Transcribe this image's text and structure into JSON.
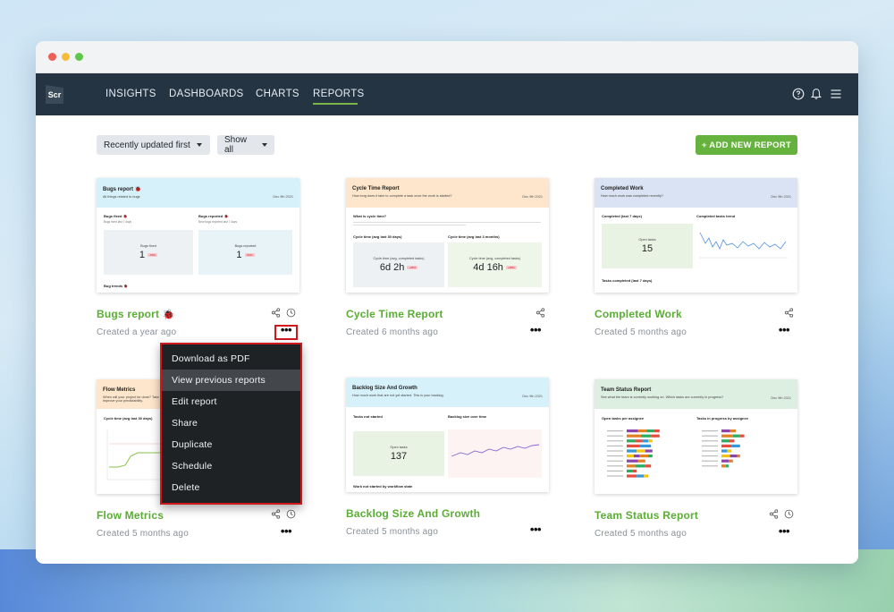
{
  "nav": {
    "logo": "Scr",
    "items": [
      "INSIGHTS",
      "DASHBOARDS",
      "CHARTS",
      "REPORTS"
    ],
    "active": "REPORTS"
  },
  "toolbar": {
    "sort_label": "Recently updated first",
    "filter_label": "Show all",
    "add_label": "+ ADD NEW REPORT"
  },
  "colors": {
    "accent": "#66b23f",
    "nav_bg": "#253443",
    "highlight": "#d0171c"
  },
  "reports": [
    {
      "title": "Bugs report",
      "emoji": "🐞",
      "created": "Created a year ago",
      "thumb": {
        "header": "Bugs report 🐞",
        "sub": "All things related to bugs",
        "date": "Dec 9th 2021",
        "left_label": "Bugs fixed 🐞",
        "left_sub": "Bugs fixed last 7 days",
        "left_cap": "Bugs fixed",
        "left_value": "1",
        "left_badge": "-50%",
        "right_label": "Bugs reported 🐞",
        "right_sub": "New bugs reported last 7 days",
        "right_cap": "Bugs reported",
        "right_value": "1",
        "right_badge": "-50%",
        "footer": "Bug trends 🐞"
      }
    },
    {
      "title": "Cycle Time Report",
      "created": "Created 6 months ago",
      "thumb": {
        "header": "Cycle Time Report",
        "sub": "How long does it take to complete a task once the work is started?",
        "date": "Dec 9th 2021",
        "question": "What is cycle time?",
        "left_label": "Cycle time (avg last 30 days)",
        "left_cap": "Cycle time (avg, completed tasks)",
        "left_value": "6d 2h",
        "left_badge": "+46%",
        "right_label": "Cycle time (avg last 3 months)",
        "right_cap": "Cycle time (avg, completed tasks)",
        "right_value": "4d 16h",
        "right_badge": "+46%"
      }
    },
    {
      "title": "Completed Work",
      "created": "Created 5 months ago",
      "thumb": {
        "header": "Completed Work",
        "sub": "How much work was completed recently?",
        "date": "Dec 9th 2021",
        "left_label": "Completed (last 7 days)",
        "left_cap": "Open tasks",
        "left_value": "15",
        "right_label": "Completed tasks trend",
        "footer": "Tasks completed (last 7 days)"
      }
    },
    {
      "title": "Flow Metrics",
      "created": "Created 5 months ago",
      "thumb": {
        "header": "Flow Metrics",
        "sub": "When will your project be done? Take improve your predictability.",
        "label": "Cycle time (avg last 30 days)"
      }
    },
    {
      "title": "Backlog Size And Growth",
      "created": "Created 5 months ago",
      "thumb": {
        "header": "Backlog Size And Growth",
        "sub": "How much work that are not yet started. This is your backlog.",
        "date": "Dec 9th 2021",
        "left_label": "Tasks not started",
        "left_cap": "Open tasks",
        "left_value": "137",
        "right_label": "Backlog size over time",
        "footer": "Work not started by workflow state"
      }
    },
    {
      "title": "Team Status Report",
      "created": "Created 5 months ago",
      "thumb": {
        "header": "Team Status Report",
        "sub": "See what the team is currently working on. Which tasks are currently in progress?",
        "date": "Dec 9th 2021",
        "left_label": "Open tasks per assignee",
        "right_label": "Tasks in progress by assignee"
      }
    }
  ],
  "menu": {
    "items": [
      "Download as PDF",
      "View previous reports",
      "Edit report",
      "Share",
      "Duplicate",
      "Schedule",
      "Delete"
    ],
    "hovered": "View previous reports"
  }
}
